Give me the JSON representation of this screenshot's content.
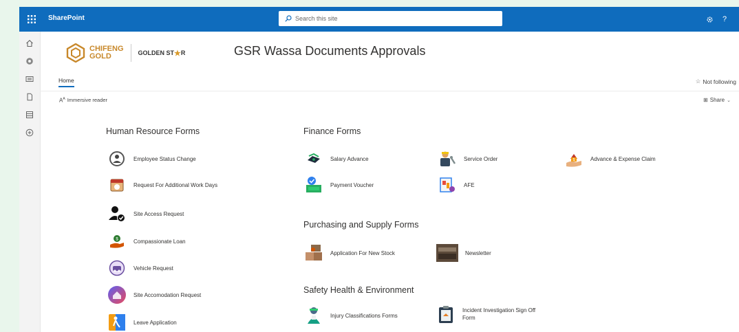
{
  "suitebar": {
    "app_name": "SharePoint",
    "search_placeholder": "Search this site",
    "settings_icon": "gear-icon",
    "help_label": "?"
  },
  "left_rail": [
    "home-icon",
    "globe-icon",
    "news-icon",
    "file-icon",
    "library-icon",
    "add-icon"
  ],
  "site": {
    "logo_name_line1": "CHIFENG",
    "logo_name_line2": "GOLD",
    "logo_partner_left": "GOLDEN ST",
    "logo_partner_right": "R",
    "title": "GSR Wassa Documents Approvals"
  },
  "nav": {
    "home": "Home",
    "follow": "Not following"
  },
  "commandbar": {
    "immersive_reader": "Immersive reader",
    "share": "Share"
  },
  "sections": {
    "hr": {
      "title": "Human Resource Forms",
      "items": [
        {
          "label": "Employee Status Change",
          "icon": "employee-status-icon"
        },
        {
          "label": "Request For Additional Work Days",
          "icon": "calendar-request-icon"
        },
        {
          "label": "Site Access Request",
          "icon": "user-check-icon"
        },
        {
          "label": "Compassionate Loan",
          "icon": "loan-hand-icon"
        },
        {
          "label": "Vehicle Request",
          "icon": "vehicle-icon"
        },
        {
          "label": "Site Accomodation Request",
          "icon": "accommodation-icon"
        },
        {
          "label": "Leave Application",
          "icon": "leave-icon"
        }
      ]
    },
    "finance": {
      "title": "Finance Forms",
      "items": [
        {
          "label": "Salary Advance",
          "icon": "salary-advance-icon"
        },
        {
          "label": "Service Order",
          "icon": "service-order-icon"
        },
        {
          "label": "Advance & Expense Claim",
          "icon": "expense-claim-icon"
        },
        {
          "label": "Payment Voucher",
          "icon": "payment-voucher-icon"
        },
        {
          "label": "AFE",
          "icon": "afe-icon"
        }
      ]
    },
    "purchasing": {
      "title": "Purchasing and Supply Forms",
      "items": [
        {
          "label": "Application For New Stock",
          "icon": "stock-icon"
        },
        {
          "label": "Newsletter",
          "icon": "newsletter-icon"
        }
      ]
    },
    "safety": {
      "title": "Safety Health & Environment",
      "items": [
        {
          "label": "Injury Classifications Forms",
          "icon": "injury-icon"
        },
        {
          "label": "Incident Investigation Sign Off Form",
          "icon": "incident-clipboard-icon"
        }
      ]
    }
  },
  "colors": {
    "suitebar": "#0f6cbd",
    "background": "#e9f6ec",
    "logo_gold": "#c8882a"
  }
}
